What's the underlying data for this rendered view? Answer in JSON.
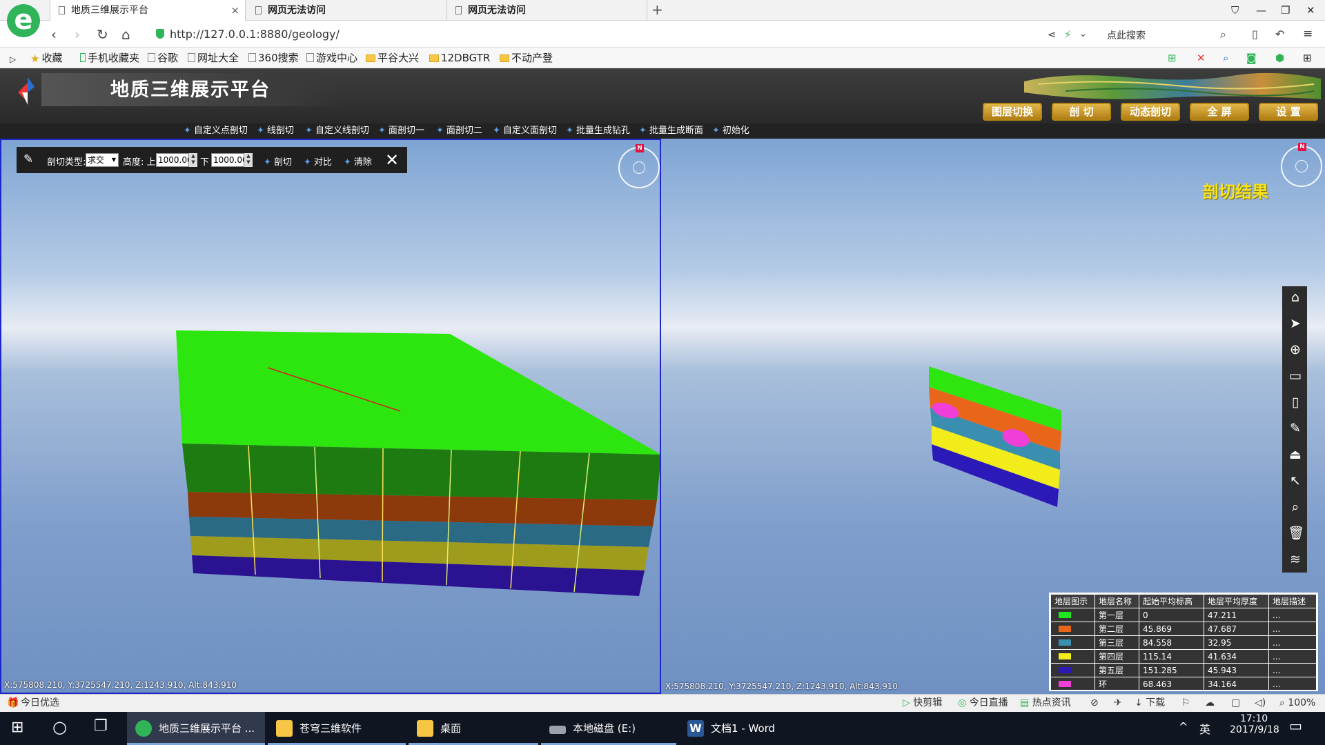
{
  "browser": {
    "tabs": [
      {
        "title": "地质三维展示平台",
        "active": true
      },
      {
        "title": "网页无法访问",
        "active": false
      },
      {
        "title": "网页无法访问",
        "active": false
      }
    ],
    "url": "http://127.0.0.1:8880/geology/",
    "search_placeholder": "点此搜索",
    "bookmarks": [
      "收藏",
      "手机收藏夹",
      "谷歌",
      "网址大全",
      "360搜索",
      "游戏中心",
      "平谷大兴",
      "12DBGTR",
      "不动产登"
    ]
  },
  "app": {
    "title": "地质三维展示平台",
    "top_buttons": [
      "图层切换",
      "剖 切",
      "动态剖切",
      "全 屏",
      "设 置"
    ],
    "toolbar": [
      "自定义点剖切",
      "线剖切",
      "自定义线剖切",
      "面剖切一",
      "面剖切二",
      "自定义面剖切",
      "批量生成钻孔",
      "批量生成断面",
      "初始化"
    ]
  },
  "clip_panel": {
    "type_label": "剖切类型:",
    "type_value": "求交",
    "height_label": "高度: 上",
    "upper_value": "1000.00",
    "lower_label": "下",
    "lower_value": "1000.00",
    "buttons": [
      "剖切",
      "对比",
      "清除"
    ]
  },
  "left_view": {
    "coords": "X:575808.210, Y:3725547.210, Z:1243.910, Alt:843.910"
  },
  "right_view": {
    "coords": "X:575808.210, Y:3725547.210, Z:1243.910, Alt:843.910",
    "result_label": "剖切结果"
  },
  "legend": {
    "headers": [
      "地层图示",
      "地层名称",
      "起始平均标高",
      "地层平均厚度",
      "地层描述"
    ],
    "rows": [
      {
        "color": "#1ee51e",
        "name": "第一层",
        "start": "0",
        "thickness": "47.211",
        "desc": "..."
      },
      {
        "color": "#e8651a",
        "name": "第二层",
        "start": "45.869",
        "thickness": "47.687",
        "desc": "..."
      },
      {
        "color": "#3a8fb0",
        "name": "第三层",
        "start": "84.558",
        "thickness": "32.95",
        "desc": "..."
      },
      {
        "color": "#f2ec1a",
        "name": "第四层",
        "start": "115.14",
        "thickness": "41.634",
        "desc": "..."
      },
      {
        "color": "#2b1ab8",
        "name": "第五层",
        "start": "151.285",
        "thickness": "45.943",
        "desc": "..."
      },
      {
        "color": "#f03fd8",
        "name": "环",
        "start": "68.463",
        "thickness": "34.164",
        "desc": "..."
      }
    ]
  },
  "statusbar": {
    "left": "今日优选",
    "right_items": [
      "快剪辑",
      "今日直播",
      "热点资讯",
      "下载",
      "100%"
    ]
  },
  "taskbar": {
    "tasks": [
      "地质三维展示平台 ...",
      "苍穹三维软件",
      "桌面",
      "本地磁盘 (E:)",
      "文档1 - Word"
    ],
    "ime": "英",
    "time": "17:10",
    "date": "2017/9/18"
  }
}
